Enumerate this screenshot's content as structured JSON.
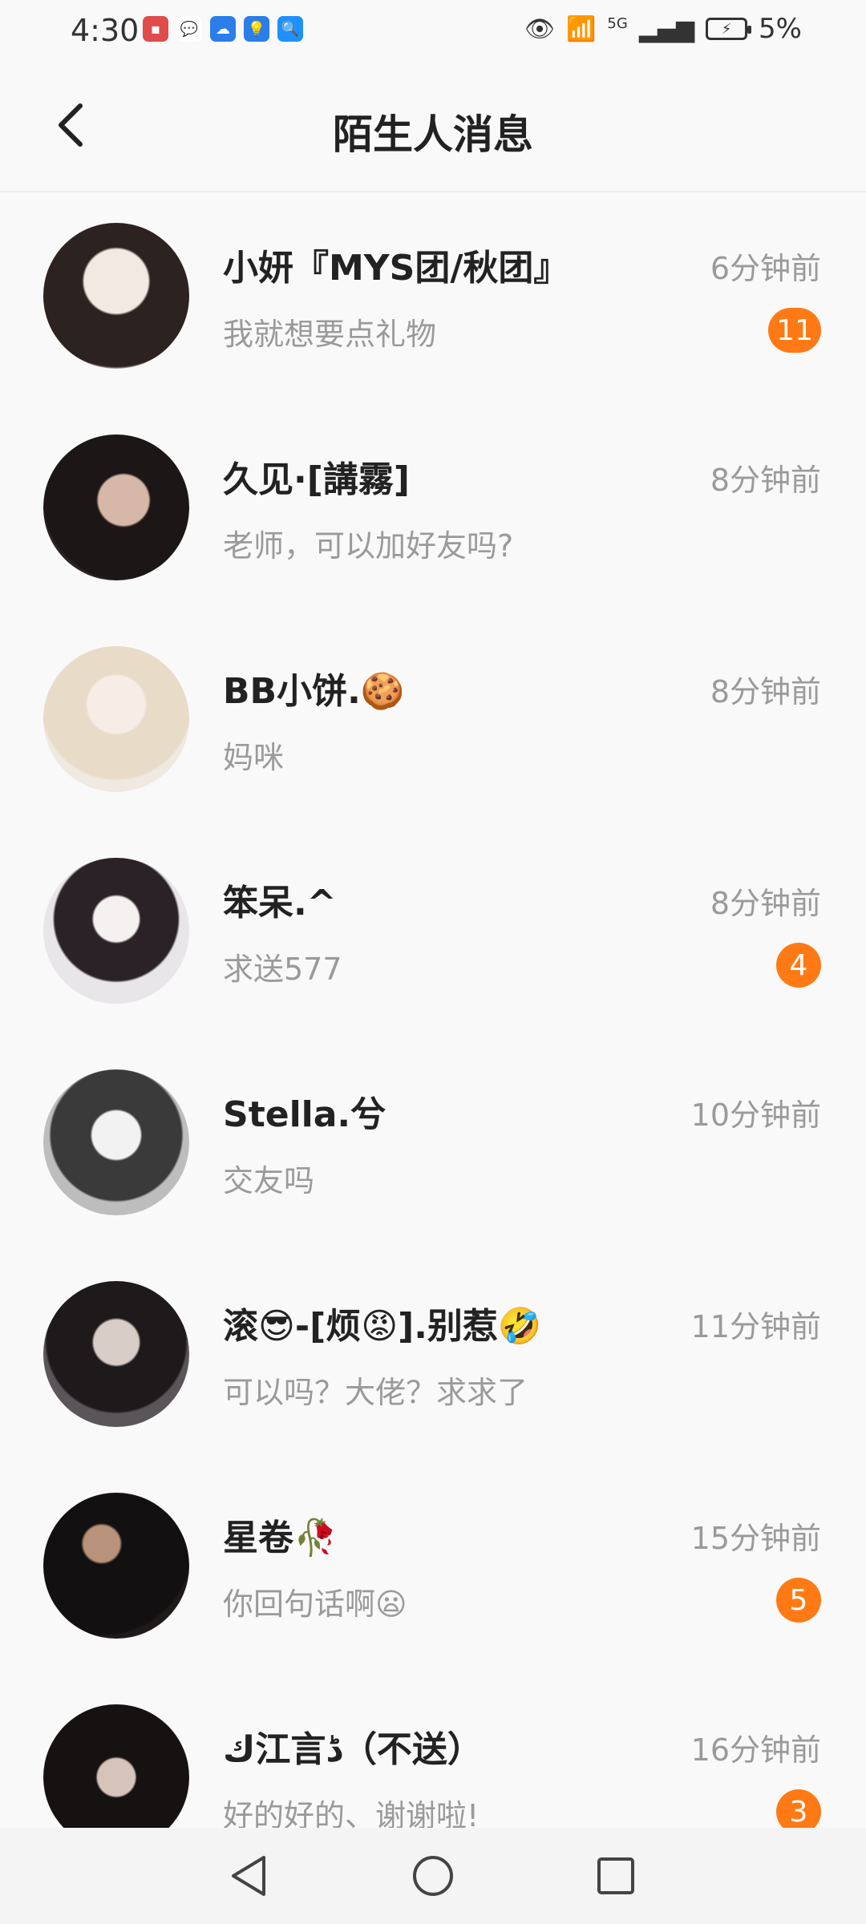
{
  "status_bar": {
    "time": "4:30",
    "battery": "5%",
    "network": "5G"
  },
  "header": {
    "title": "陌生人消息",
    "back_icon": "chevron-left-icon"
  },
  "colors": {
    "accent_badge": "#ff7a14",
    "muted_text": "#9a9a9a"
  },
  "conversations": [
    {
      "name": "小妍『MYS团/秋团』",
      "time": "6分钟前",
      "preview": "我就想要点礼物",
      "badge": "11",
      "avatar_color": "#d8cfc8"
    },
    {
      "name": "久见·[講霧]",
      "time": "8分钟前",
      "preview": "老师，可以加好友吗?",
      "badge": "",
      "avatar_color": "#2d2626"
    },
    {
      "name": "BB小饼.🍪",
      "time": "8分钟前",
      "preview": "妈咪",
      "badge": "",
      "avatar_color": "#efe9e1"
    },
    {
      "name": "笨呆.^",
      "time": "8分钟前",
      "preview": "求送577",
      "badge": "4",
      "avatar_color": "#e9e6e9"
    },
    {
      "name": "Stella.兮",
      "time": "10分钟前",
      "preview": "交友吗",
      "badge": "",
      "avatar_color": "#bdbdbd"
    },
    {
      "name": "滚😎-[烦😡].别惹🤣",
      "time": "11分钟前",
      "preview": "可以吗？大佬？求求了",
      "badge": "",
      "avatar_color": "#5a5558"
    },
    {
      "name": "星卷🥀",
      "time": "15分钟前",
      "preview": "你回句话啊😦",
      "badge": "5",
      "avatar_color": "#1f1b1b"
    },
    {
      "name": "ك江言ڈ（不送）",
      "time": "16分钟前",
      "preview": "好的好的、谢谢啦!",
      "badge": "3",
      "avatar_color": "#3b3434"
    }
  ],
  "nav": {
    "back": "nav-back-icon",
    "home": "nav-home-icon",
    "recents": "nav-recents-icon"
  }
}
